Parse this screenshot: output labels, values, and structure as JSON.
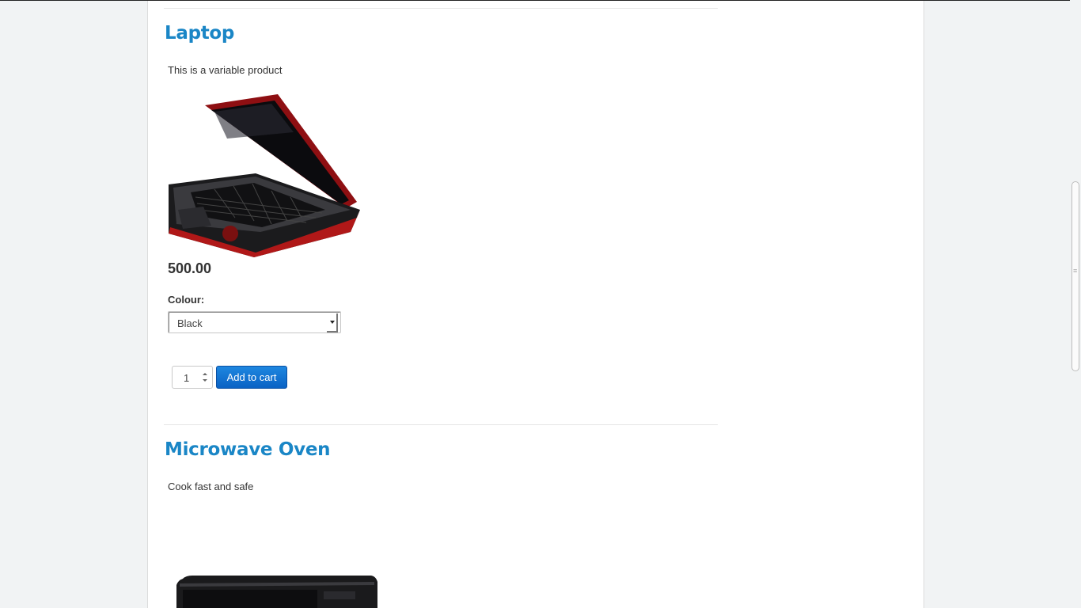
{
  "products": [
    {
      "title": "Laptop",
      "description": "This is a variable product",
      "image_icon": "laptop-image",
      "price": "500.00",
      "attribute_label": "Colour:",
      "attribute_selected": "Black",
      "quantity": "1",
      "add_to_cart_label": "Add to cart"
    },
    {
      "title": "Microwave Oven",
      "description": "Cook fast and safe",
      "image_icon": "microwave-image"
    }
  ],
  "colors": {
    "title": "#1a86c6",
    "button": "#0a62c4",
    "laptop_body": "#b01818"
  }
}
